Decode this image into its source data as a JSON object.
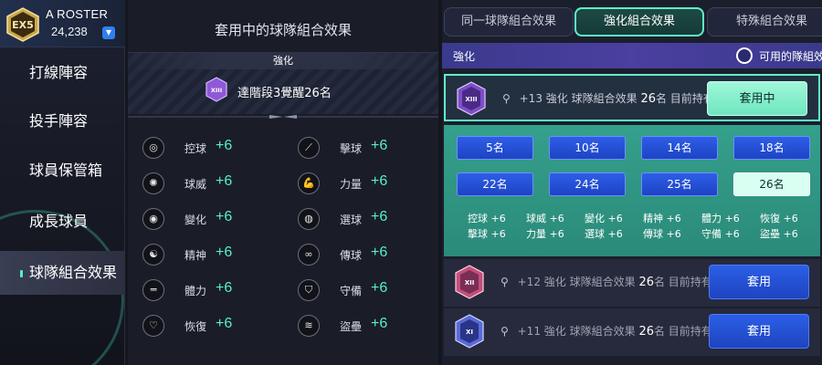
{
  "roster": {
    "rank": "EX5",
    "label": "A ROSTER",
    "points": "24,238"
  },
  "nav": [
    {
      "label": "打線陣容"
    },
    {
      "label": "投手陣容"
    },
    {
      "label": "球員保管箱"
    },
    {
      "label": "成長球員"
    },
    {
      "label": "球隊組合效果"
    }
  ],
  "middle": {
    "title": "套用中的球隊組合效果",
    "banner_head": "強化",
    "banner_badge": "XIII",
    "banner_text": "達階段3覺醒26名",
    "stats": [
      {
        "icon": "target-icon",
        "name": "控球",
        "value": "+6"
      },
      {
        "icon": "bat-icon",
        "name": "擊球",
        "value": "+6"
      },
      {
        "icon": "fastball-icon",
        "name": "球威",
        "value": "+6"
      },
      {
        "icon": "muscle-icon",
        "name": "力量",
        "value": "+6"
      },
      {
        "icon": "curveball-icon",
        "name": "變化",
        "value": "+6"
      },
      {
        "icon": "eye-icon",
        "name": "選球",
        "value": "+6"
      },
      {
        "icon": "brain-icon",
        "name": "精神",
        "value": "+6"
      },
      {
        "icon": "throw-icon",
        "name": "傳球",
        "value": "+6"
      },
      {
        "icon": "dumbbell-icon",
        "name": "體力",
        "value": "+6"
      },
      {
        "icon": "shield-icon",
        "name": "守備",
        "value": "+6"
      },
      {
        "icon": "heart-icon",
        "name": "恢復",
        "value": "+6"
      },
      {
        "icon": "steal-icon",
        "name": "盜壘",
        "value": "+6"
      }
    ]
  },
  "tabs": [
    {
      "label": "同一球隊組合效果"
    },
    {
      "label": "強化組合效果"
    },
    {
      "label": "特殊組合效果"
    }
  ],
  "strength_bar": {
    "label": "強化",
    "available_label": "可用的隊組效果"
  },
  "combos": [
    {
      "badge": "XIII",
      "level": "+13",
      "type": "強化 球隊組合效果",
      "count": "26",
      "suffix": "名 目前持有",
      "button": "套用中"
    },
    {
      "badge": "XII",
      "level": "+12",
      "type": "強化 球隊組合效果",
      "count": "26",
      "suffix": "名 目前持有",
      "button": "套用"
    },
    {
      "badge": "XI",
      "level": "+11",
      "type": "強化 球隊組合效果",
      "count": "26",
      "suffix": "名 目前持有",
      "button": "套用"
    }
  ],
  "members": [
    "5名",
    "10名",
    "14名",
    "18名",
    "22名",
    "24名",
    "25名",
    "26名"
  ],
  "bonus_cols": [
    {
      "l1": "控球 +6",
      "l2": "擊球 +6"
    },
    {
      "l1": "球威 +6",
      "l2": "力量 +6"
    },
    {
      "l1": "變化 +6",
      "l2": "選球 +6"
    },
    {
      "l1": "精神 +6",
      "l2": "傳球 +6"
    },
    {
      "l1": "體力 +6",
      "l2": "守備 +6"
    },
    {
      "l1": "恢復 +6",
      "l2": "盜壘 +6"
    }
  ],
  "colors": {
    "accent": "#5ff2cb",
    "blue": "#2b5fe6",
    "panel": "#2b8a79"
  }
}
